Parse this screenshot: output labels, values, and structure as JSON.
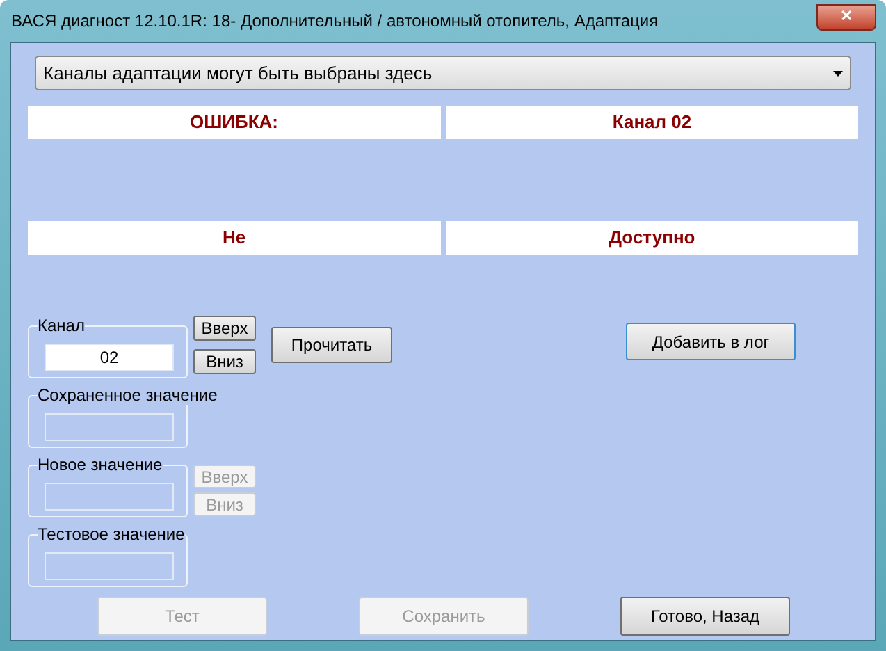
{
  "window": {
    "title": "ВАСЯ диагност 12.10.1R: 18- Дополнительный / автономный отопитель, Адаптация",
    "close": "✕"
  },
  "channel_select": {
    "value": "Каналы адаптации могут быть выбраны здесь"
  },
  "status_rows": [
    [
      "ОШИБКА:",
      "Канал 02"
    ],
    [
      "Не",
      "Доступно"
    ]
  ],
  "channel": {
    "label": "Канал",
    "value": "02",
    "disabled": false,
    "buttons": [
      {
        "label": "Вверх",
        "disabled": false
      },
      {
        "label": "Вниз",
        "disabled": false
      }
    ]
  },
  "read_button": {
    "label": "Прочитать",
    "disabled": false
  },
  "log_button": {
    "label": "Добавить в лог",
    "disabled": false
  },
  "saved_value": {
    "label": "Сохраненное значение",
    "disabled": true
  },
  "new_value": {
    "label": "Новое значение",
    "disabled": true,
    "buttons": [
      {
        "label": "Вверх",
        "disabled": true
      },
      {
        "label": "Вниз",
        "disabled": true
      }
    ]
  },
  "test_value": {
    "label": "Тестовое значение",
    "disabled": true
  },
  "bottom_buttons": [
    {
      "label": "Тест",
      "disabled": true
    },
    {
      "label": "Сохранить",
      "disabled": true
    },
    {
      "label": "Готово, Назад",
      "disabled": false
    }
  ]
}
